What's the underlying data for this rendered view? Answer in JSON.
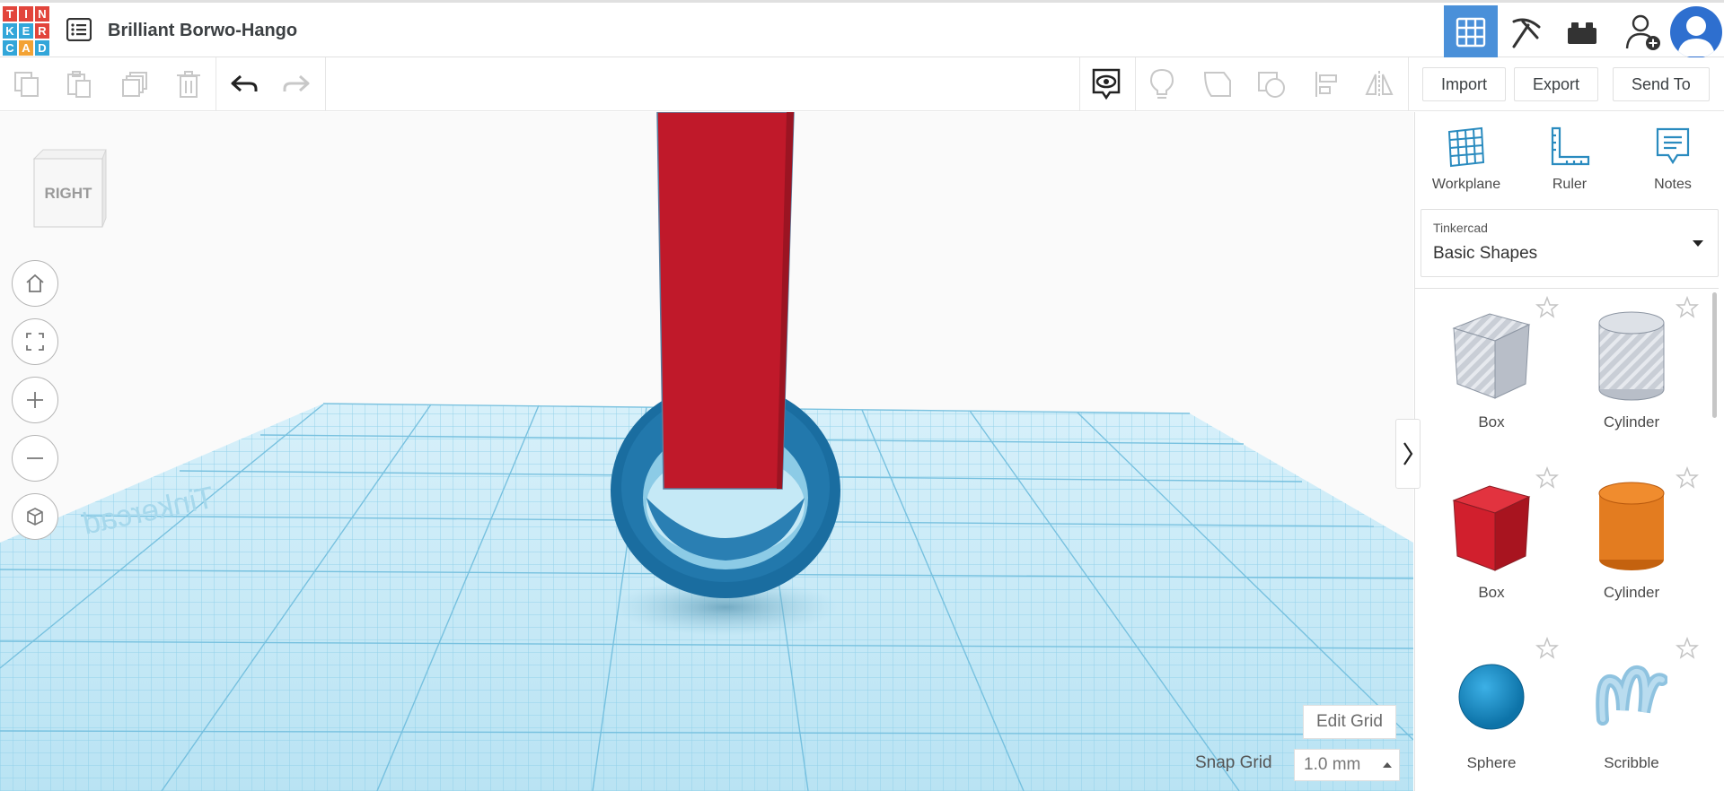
{
  "logo": {
    "letters": [
      "T",
      "I",
      "N",
      "K",
      "E",
      "R",
      "C",
      "A",
      "D"
    ],
    "colors": [
      "#e2453c",
      "#e2453c",
      "#e2453c",
      "#32a6d9",
      "#32a6d9",
      "#e2453c",
      "#32a6d9",
      "#f3a233",
      "#32a6d9"
    ]
  },
  "header": {
    "title": "Brilliant Borwo-Hango",
    "buttons": [
      "3d-design-icon",
      "simulator-pickaxe-icon",
      "bricks-icon",
      "add-user-icon",
      "avatar-icon"
    ]
  },
  "toolbar": {
    "icons": [
      "copy-icon",
      "paste-icon",
      "duplicate-icon",
      "delete-icon",
      "undo-icon",
      "redo-icon",
      "notes-visibility-icon",
      "light-bulb-icon",
      "shape-cut-icon",
      "shape-group-icon",
      "align-icon",
      "mirror-icon"
    ],
    "import_label": "Import",
    "export_label": "Export",
    "sendto_label": "Send To"
  },
  "viewport": {
    "view_cube_face": "RIGHT",
    "controls": [
      "home-view-icon",
      "fit-view-icon",
      "zoom-in-icon",
      "zoom-out-icon",
      "perspective-icon"
    ],
    "edit_grid_label": "Edit Grid",
    "snap_grid_label": "Snap Grid",
    "snap_grid_value": "1.0 mm",
    "workplane_color": "#bfe6f4",
    "grid_line_color": "#7cc5e2",
    "objects": [
      {
        "shape": "box",
        "color": "#c0192a"
      },
      {
        "shape": "tube",
        "color": "#1a6da0"
      }
    ]
  },
  "right_panel": {
    "tools": [
      {
        "label": "Workplane",
        "icon": "workplane-icon"
      },
      {
        "label": "Ruler",
        "icon": "ruler-icon"
      },
      {
        "label": "Notes",
        "icon": "notes-icon"
      }
    ],
    "library_category": "Tinkercad",
    "library_name": "Basic Shapes",
    "shapes": [
      {
        "label": "Box",
        "kind": "box-hole"
      },
      {
        "label": "Cylinder",
        "kind": "cylinder-hole"
      },
      {
        "label": "Box",
        "kind": "box"
      },
      {
        "label": "Cylinder",
        "kind": "cylinder"
      },
      {
        "label": "Sphere",
        "kind": "sphere"
      },
      {
        "label": "Scribble",
        "kind": "scribble"
      }
    ]
  }
}
